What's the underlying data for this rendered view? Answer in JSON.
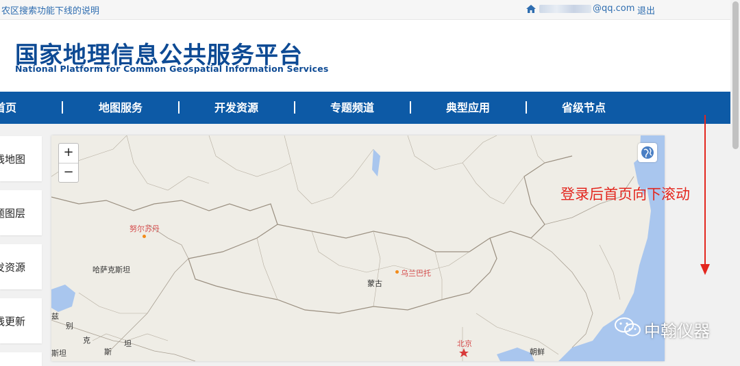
{
  "topbar": {
    "notice": "农区搜索功能下线的说明",
    "user_email": "@qq.com",
    "logout": "退出"
  },
  "header": {
    "title_cn": "国家地理信息公共服务平台",
    "title_en": "National Platform for Common Geospatial Information Services"
  },
  "nav": {
    "items": [
      "首页",
      "地图服务",
      "开发资源",
      "专题频道",
      "典型应用",
      "省级节点"
    ]
  },
  "sidebar": {
    "items": [
      "线地图",
      "题图层",
      "发资源",
      "线更新"
    ]
  },
  "map": {
    "zoom_in": "+",
    "zoom_out": "−",
    "labels": {
      "nursultan": "努尔苏丹",
      "kazakhstan": "哈萨克斯坦",
      "mongolia": "蒙古",
      "ulaanbaatar": "乌兰巴托",
      "beijing": "北京",
      "korea": "朝鲜",
      "uz1": "兹",
      "uz2": "别",
      "uz3": "克",
      "tj": "坦",
      "tkm": "斯坦",
      "pak": "斯"
    }
  },
  "annotation": {
    "text": "登录后首页向下滚动"
  },
  "watermark": {
    "text": "中翰仪器"
  },
  "colors": {
    "brand_blue": "#0d4a94",
    "nav_blue": "#0d5aa6",
    "annotation_red": "#e3261e",
    "map_water": "#a9c6ee"
  },
  "icons": [
    "home-icon",
    "layer-switch-icon",
    "wechat-icon"
  ]
}
